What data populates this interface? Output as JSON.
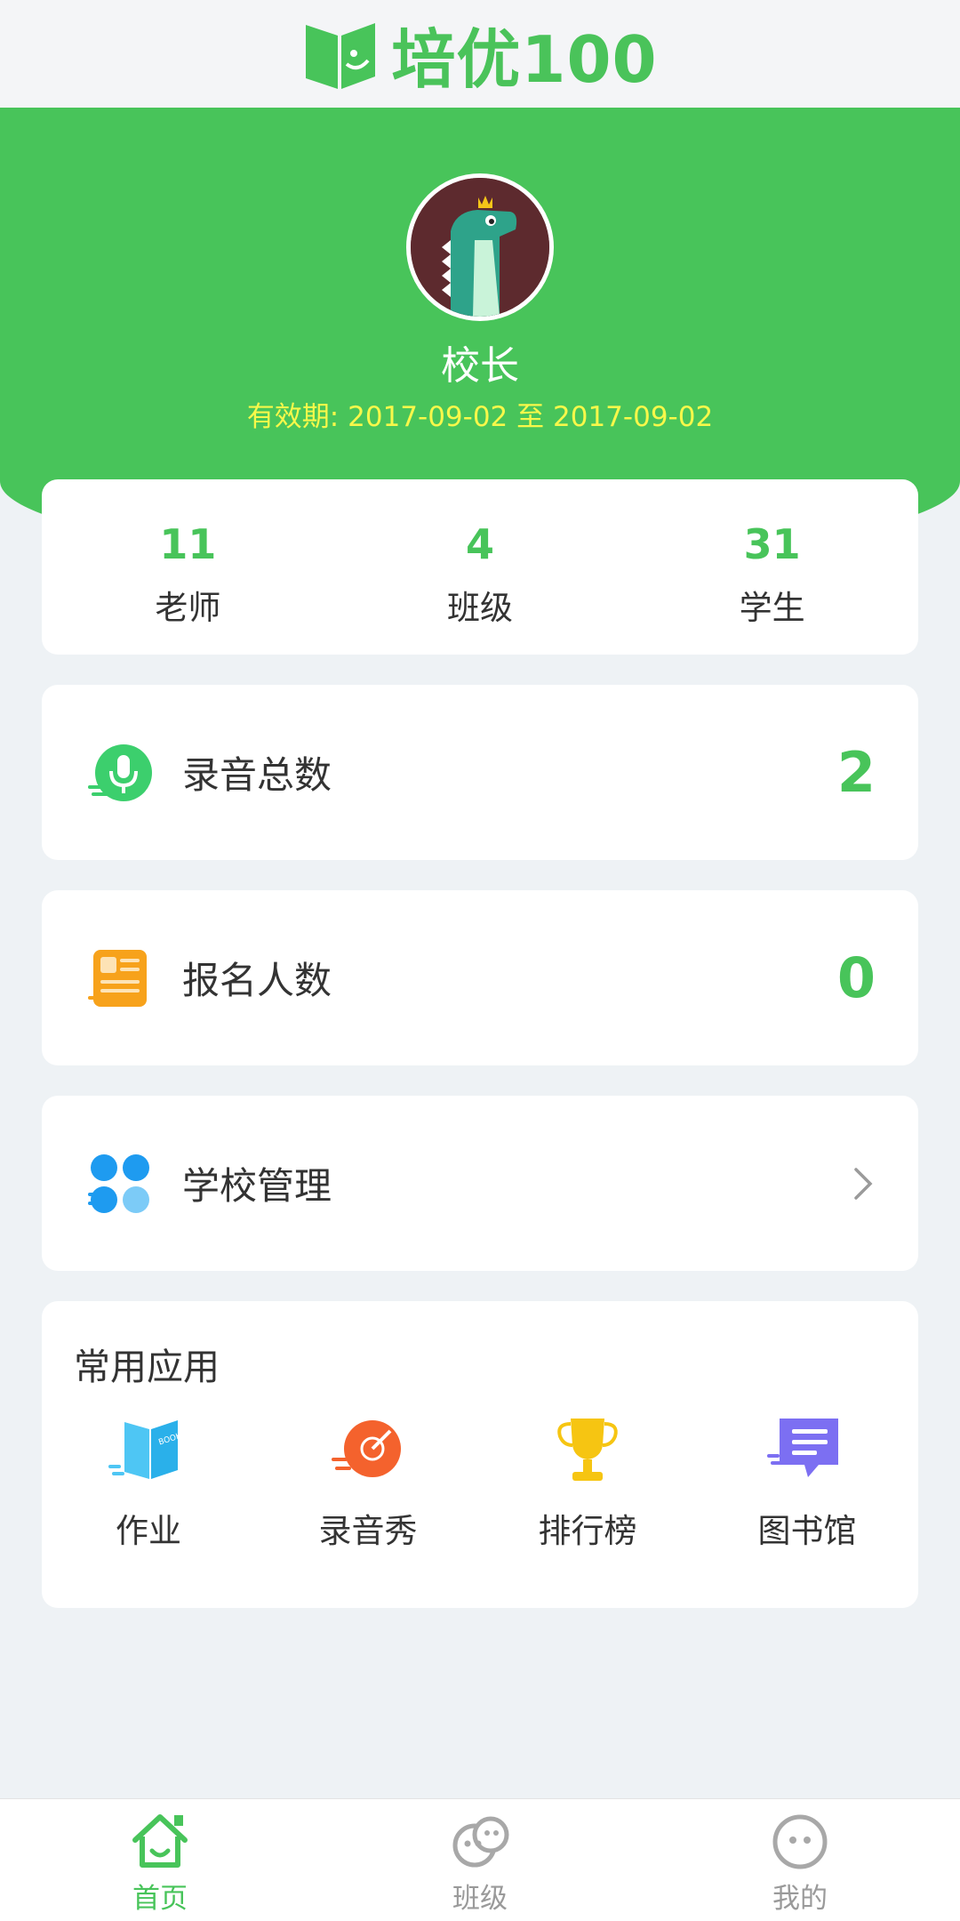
{
  "header": {
    "brand_name": "培优100"
  },
  "profile": {
    "name": "校长",
    "validity_label": "有效期: ",
    "validity_start": "2017-09-02",
    "validity_sep": " 至 ",
    "validity_end": "2017-09-02"
  },
  "stats": [
    {
      "value": "11",
      "label": "老师"
    },
    {
      "value": "4",
      "label": "班级"
    },
    {
      "value": "31",
      "label": "学生"
    }
  ],
  "rows": [
    {
      "label": "录音总数",
      "value": "2",
      "icon": "microphone-icon"
    },
    {
      "label": "报名人数",
      "value": "0",
      "icon": "document-icon"
    },
    {
      "label": "学校管理",
      "icon": "grid-icon",
      "arrow": "chevron-right-icon"
    }
  ],
  "apps": {
    "title": "常用应用",
    "items": [
      {
        "label": "作业",
        "icon": "book-icon"
      },
      {
        "label": "录音秀",
        "icon": "record-icon"
      },
      {
        "label": "排行榜",
        "icon": "trophy-icon"
      },
      {
        "label": "图书馆",
        "icon": "library-icon"
      }
    ]
  },
  "tabbar": {
    "items": [
      {
        "label": "首页",
        "icon": "home-icon",
        "active": true
      },
      {
        "label": "班级",
        "icon": "class-icon",
        "active": false
      },
      {
        "label": "我的",
        "icon": "profile-icon",
        "active": false
      }
    ]
  },
  "colors": {
    "primary": "#48c45a",
    "validity": "#f7f84a",
    "background": "#eef2f5"
  }
}
